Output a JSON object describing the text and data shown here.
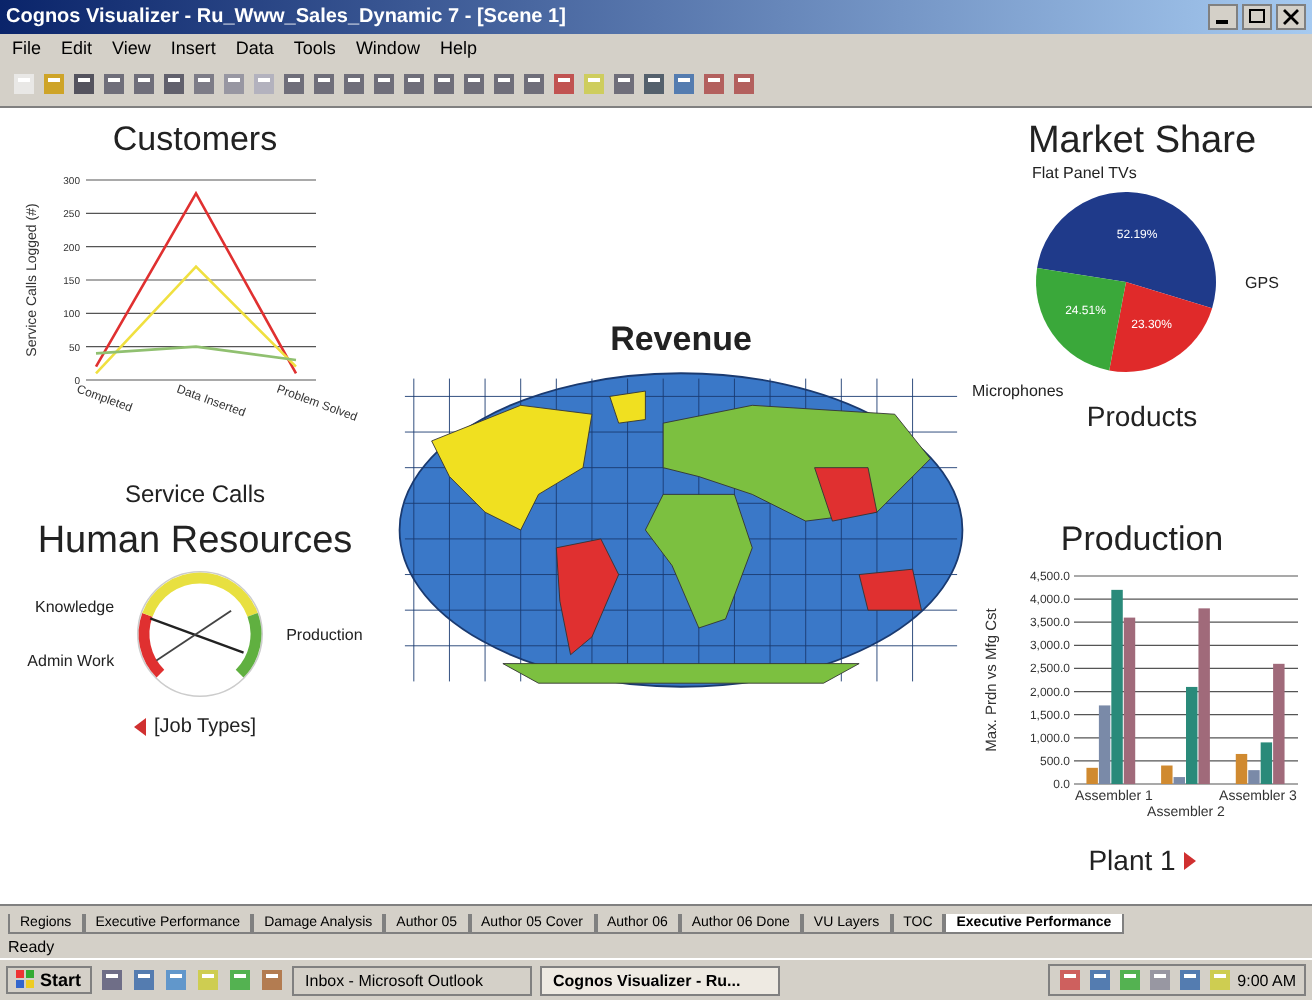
{
  "window": {
    "title": "Cognos Visualizer - Ru_Www_Sales_Dynamic 7 - [Scene 1]"
  },
  "menu": [
    "File",
    "Edit",
    "View",
    "Insert",
    "Data",
    "Tools",
    "Window",
    "Help"
  ],
  "customers": {
    "title": "Customers",
    "xlabel_text": "Service Calls",
    "chart_data": {
      "type": "line",
      "grid": true,
      "ylabel": "Service Calls Logged (#)",
      "categories": [
        "Completed",
        "Data Inserted",
        "Problem Solved"
      ],
      "yticks": [
        0,
        50,
        100,
        150,
        200,
        250,
        300
      ],
      "ylim": [
        0,
        300
      ],
      "series": [
        {
          "color": "#e03030",
          "values": [
            20,
            280,
            10
          ]
        },
        {
          "color": "#f0e040",
          "values": [
            10,
            170,
            20
          ]
        },
        {
          "color": "#90c070",
          "values": [
            40,
            50,
            30
          ]
        }
      ]
    }
  },
  "market_share": {
    "title": "Market Share",
    "xlabel_text": "Products",
    "chart_data": {
      "type": "pie",
      "categories": [
        "Flat Panel TVs",
        "GPS",
        "Microphones"
      ],
      "values": [
        52.19,
        23.3,
        24.51
      ],
      "value_labels": [
        "52.19%",
        "23.30%",
        "24.51%"
      ],
      "colors": [
        "#1f3a8a",
        "#e02a2a",
        "#3aa83a"
      ]
    }
  },
  "revenue": {
    "title": "Revenue"
  },
  "human_resources": {
    "title": "Human Resources",
    "labels": [
      "Knowledge",
      "Admin Work",
      "Production"
    ],
    "nav_label": "[Job Types]"
  },
  "production": {
    "title": "Production",
    "xlabel_text": "Plant 1",
    "chart_data": {
      "type": "bar",
      "grid": true,
      "ylabel": "Max. Prdn vs Mfg Cst",
      "categories": [
        "Assembler 1",
        "Assembler 2",
        "Assembler 3"
      ],
      "ylim": [
        0,
        4500
      ],
      "yticks": [
        {
          "value": 0,
          "label": "0.0"
        },
        {
          "value": 500,
          "label": "500.0"
        },
        {
          "value": 1000,
          "label": "1,000.0"
        },
        {
          "value": 1500,
          "label": "1,500.0"
        },
        {
          "value": 2000,
          "label": "2,000.0"
        },
        {
          "value": 2500,
          "label": "2,500.0"
        },
        {
          "value": 3000,
          "label": "3,000.0"
        },
        {
          "value": 3500,
          "label": "3,500.0"
        },
        {
          "value": 4000,
          "label": "4,000.0"
        },
        {
          "value": 4500,
          "label": "4,500.0"
        }
      ],
      "series": [
        {
          "color": "#d08a30",
          "values": [
            350,
            400,
            650
          ]
        },
        {
          "color": "#7a8aa8",
          "values": [
            1700,
            150,
            300
          ]
        },
        {
          "color": "#2a8a7a",
          "values": [
            4200,
            2100,
            900
          ]
        },
        {
          "color": "#a06a7a",
          "values": [
            3600,
            3800,
            2600
          ]
        }
      ]
    }
  },
  "tabs": [
    {
      "label": "Regions",
      "selected": false
    },
    {
      "label": "Executive Performance",
      "selected": false
    },
    {
      "label": "Damage Analysis",
      "selected": false
    },
    {
      "label": "Author 05",
      "selected": false
    },
    {
      "label": "Author 05 Cover",
      "selected": false
    },
    {
      "label": "Author 06",
      "selected": false
    },
    {
      "label": "Author 06 Done",
      "selected": false
    },
    {
      "label": "VU Layers",
      "selected": false
    },
    {
      "label": "TOC",
      "selected": false
    },
    {
      "label": "Executive Performance",
      "selected": true
    }
  ],
  "status_bar": {
    "text": "Ready"
  },
  "taskbar": {
    "start": "Start",
    "tasks": [
      {
        "label": "Inbox - Microsoft Outlook",
        "selected": false
      },
      {
        "label": "Cognos Visualizer - Ru...",
        "selected": true
      }
    ],
    "clock": "9:00 AM"
  }
}
